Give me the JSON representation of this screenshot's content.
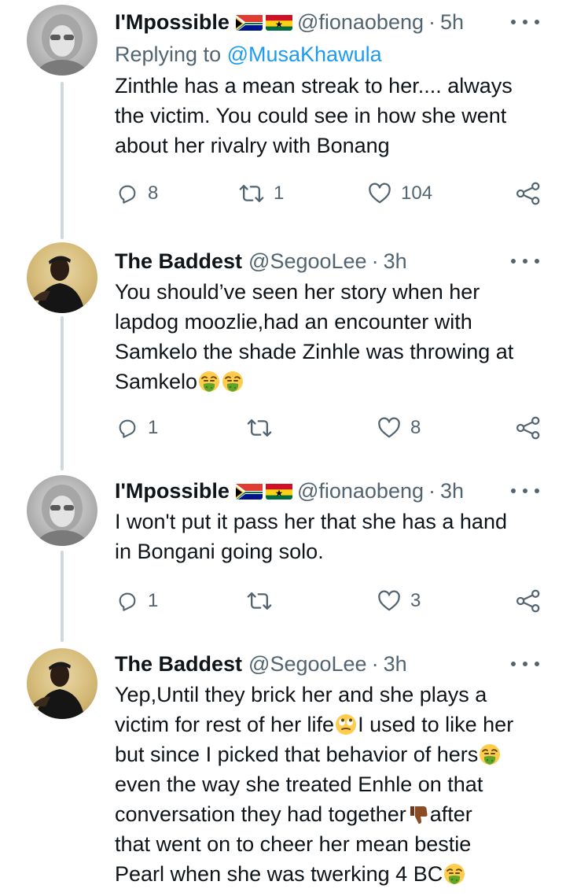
{
  "tweets": [
    {
      "name": "I'Mpossible",
      "flags": [
        "south-africa-flag",
        "ghana-flag"
      ],
      "handle": "@fionaobeng",
      "dot": "·",
      "time": "5h",
      "replying_prefix": "Replying to ",
      "replying_mention": "@MusaKhawula",
      "text_lines": [
        "Zinthle has a mean streak to her.... always",
        "the victim. You could see in how she went",
        "about her rivalry with Bonang"
      ],
      "replies": "8",
      "retweets": "1",
      "likes": "104"
    },
    {
      "name": "The Baddest",
      "handle": "@SegooLee",
      "dot": "·",
      "time": "3h",
      "text_lines": [
        "You should’ve seen her story when her",
        "lapdog moozlie,had an encounter with",
        "Samkelo the shade Zinhle was throwing at",
        "Samkelo"
      ],
      "emojis_line4": [
        "vomiting-face-emoji",
        "vomiting-face-emoji"
      ],
      "replies": "1",
      "retweets": "",
      "likes": "8"
    },
    {
      "name": "I'Mpossible",
      "flags": [
        "south-africa-flag",
        "ghana-flag"
      ],
      "handle": "@fionaobeng",
      "dot": "·",
      "time": "3h",
      "text_lines": [
        "I won't put it pass her that she has a hand",
        "in Bongani going solo."
      ],
      "replies": "1",
      "retweets": "",
      "likes": "3"
    },
    {
      "name": "The Baddest",
      "handle": "@SegooLee",
      "dot": "·",
      "time": "3h",
      "lines": {
        "l1": "Yep,Until they brick her and she plays a",
        "l2a": "victim for rest of her life",
        "l2b": "I used to like her",
        "l3": "but since I picked that behavior of hers",
        "l4": "even the way she treated Enhle on that",
        "l5a": "conversation they had together",
        "l5b": "after",
        "l6": "that went on to cheer her mean bestie",
        "l7": "Pearl when she was twerking 4 BC"
      }
    }
  ],
  "colors": {
    "text": "#0f1419",
    "secondary": "#536471",
    "link": "#1d9bf0",
    "thread_line": "#cfd9de"
  }
}
